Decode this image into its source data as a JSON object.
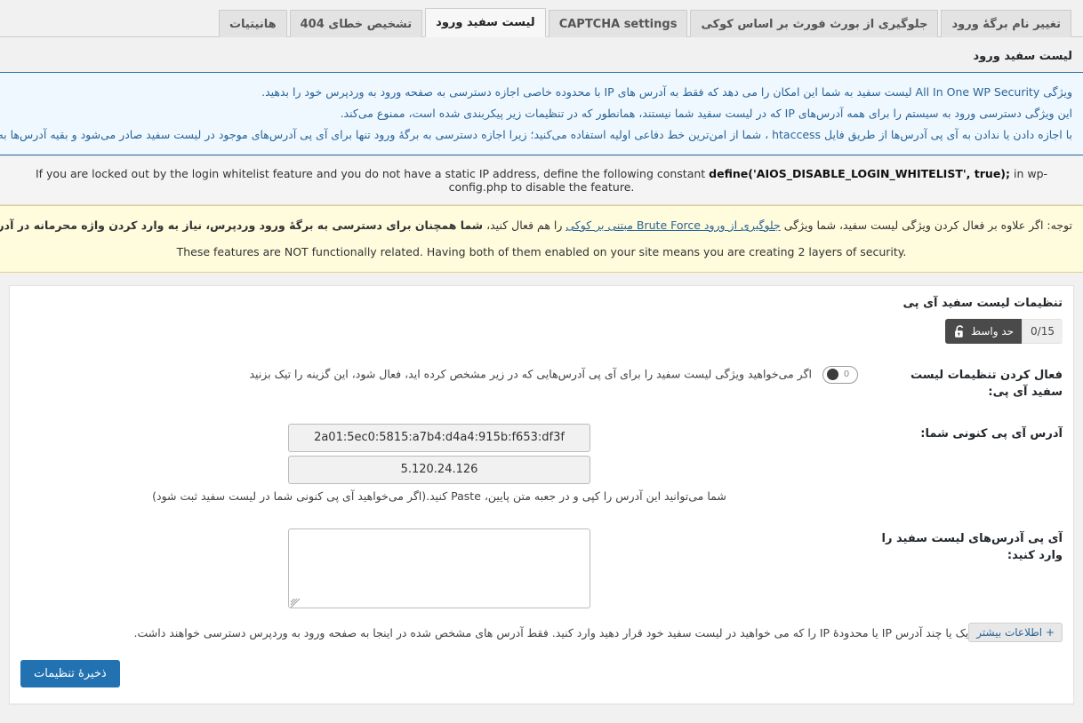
{
  "tabs": [
    {
      "label": "هانیتیات",
      "active": false
    },
    {
      "label": "تشخیص خطای 404",
      "active": false
    },
    {
      "label": "لیست سفید ورود",
      "active": true
    },
    {
      "label": "CAPTCHA settings",
      "active": false
    },
    {
      "label": "جلوگیری از بورث فورث بر اساس کوکی",
      "active": false
    },
    {
      "label": "تغییر نام برگهٔ ورود",
      "active": false
    }
  ],
  "page": {
    "title": "لیست سفید ورود"
  },
  "notices": {
    "info": [
      "ویژگی All In One WP Security لیست سفید به شما این امکان را می دهد که فقط به آدرس های IP با محدوده خاصی اجازه دسترسی به صفحه ورود به وردپرس خود را بدهید.",
      "این ویژگی دسترسی ورود به سیستم را برای همه آدرس‌های IP که در لیست سفید شما نیستند، همانطور که در تنظیمات زیر پیکربندی شده است، ممنوع می‌کند.",
      "با اجازه دادن یا ندادن به آی پی آدرس‌ها از طریق فایل htaccess ، شما از امن‌ترین خط دفاعی اولیه استفاده می‌کنید؛ زیرا اجازه دسترسی به برگهٔ ورود تنها برای آی پی آدرس‌های موجود در لیست سفید صادر می‌شود و بقیه آدرس‌ها به محض تلاش برای"
    ],
    "lockout": {
      "prefix": "If you are locked out by the login whitelist feature and you do not have a static IP address, define the following constant ",
      "code": "define('AIOS_DISABLE_LOGIN_WHITELIST', true);",
      "suffix": " in wp-config.php to disable the feature."
    },
    "warn": {
      "line1_a": "توجه: اگر علاوه بر فعال کردن ویژگی لیست سفید، شما ویژگی ",
      "line1_link": "جلوگیری از ورود Brute Force مبتنی بر کوکی",
      "line1_b": " را هم فعال کنید، ",
      "line1_bold": "شما همچنان برای دسترسی به برگهٔ ورود وردپرس، نیاز به وارد کردن واژه محرمانه در آدرس اینترنتی دارید.",
      "line2": "These features are NOT functionally related. Having both of them enabled on your site means you are creating 2 layers of security."
    }
  },
  "settings_box": {
    "title": "تنظیمات لیست سفید آی پی",
    "badge": {
      "icon": "unlock-icon",
      "level_label": "حد واسط",
      "count": "0/15"
    },
    "rows": {
      "enable": {
        "label": "فعال کردن تنظیمات لیست سفید آی پی:",
        "toggle_value": "0",
        "toggle_state": "off",
        "description": "اگر می‌خواهید ویژگی لیست سفید را برای آی پی آدرس‌هایی که در زیر مشخص کرده اید، فعال شود، این گزینه را تیک بزنید"
      },
      "current_ip": {
        "label": "آدرس آی پی کنونی شما:",
        "ipv6": "2a01:5ec0:5815:a7b4:d4a4:915b:f653:df3f",
        "ipv4": "5.120.24.126",
        "help": "شما می‌توانید این آدرس را کپی و در جعبه متن پایین، Paste کنید.(اگر می‌خواهید آی پی کنونی شما در لیست سفید ثبت شود)"
      },
      "whitelist": {
        "label": "آی پی آدرس‌های لیست سفید را وارد کنید:",
        "textarea_value": "",
        "textarea_placeholder": "",
        "help": "یک یا چند آدرس IP یا محدودهٔ IP را که می خواهید در لیست سفید خود قرار دهید وارد کنید. فقط آدرس های مشخص شده در اینجا به صفحه ورود به وردپرس دسترسی خواهند داشت.",
        "more_info_label": "+ اطلاعات بیشتر"
      }
    },
    "save_label": "ذخیرهٔ تنظیمات"
  },
  "colors": {
    "accent": "#2271b1",
    "info_bg": "#f0f8ff",
    "info_border": "#2f6fa5",
    "warn_bg": "#fffbdd",
    "warn_border": "#e0d08a",
    "badge_dark": "#4a4a4a"
  }
}
